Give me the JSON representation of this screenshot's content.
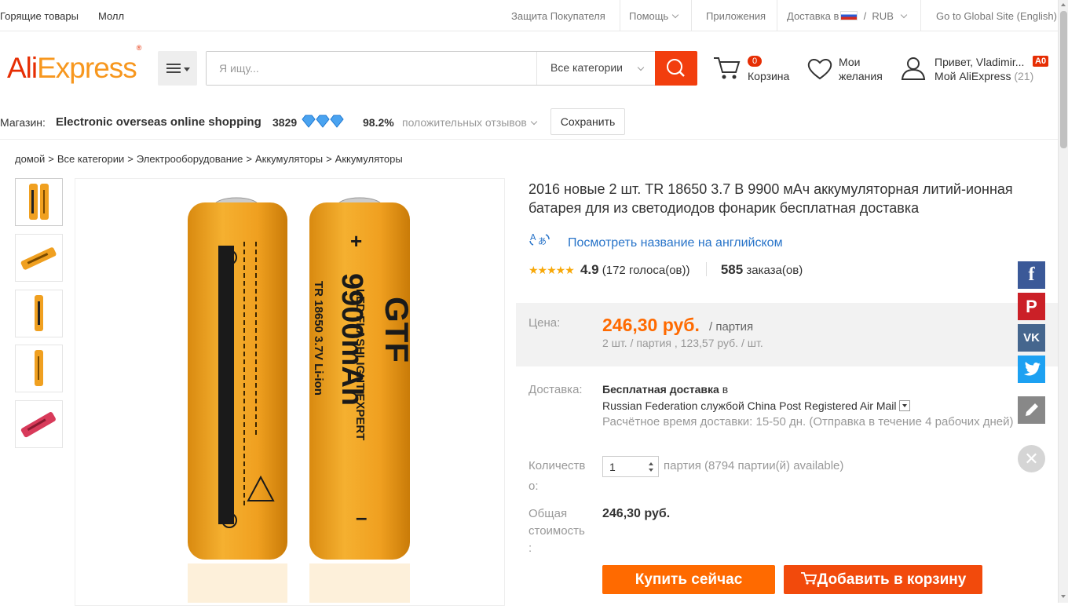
{
  "topbar": {
    "hot": "Горящие товары",
    "mall": "Молл",
    "buyer_protection": "Защита Покупателя",
    "help": "Помощь",
    "apps": "Приложения",
    "shipping_to": "Доставка в",
    "currency": "RUB",
    "global_site": "Go to Global Site (English)"
  },
  "header": {
    "logo_part1": "Ali",
    "logo_part2": "Express",
    "logo_mark": "®",
    "search_placeholder": "Я ищу...",
    "category_select": "Все категории",
    "cart_count": "0",
    "cart_label": "Корзина",
    "wishlist_line1": "Мои",
    "wishlist_line2": "желания",
    "greeting": "Привет, Vladimir...",
    "my_aliexpress": "Мой AliExpress",
    "my_count": "(21)",
    "account_badge": "A0"
  },
  "store": {
    "label": "Магазин:",
    "name": "Electronic overseas online shopping",
    "score": "3829",
    "positive_pct": "98.2%",
    "positive_label": "положительных отзывов",
    "save": "Сохранить"
  },
  "breadcrumb": [
    "домой",
    ">",
    "Все категории",
    ">",
    "Электрооборудование",
    ">",
    "Аккумуляторы",
    ">",
    "Аккумуляторы"
  ],
  "product": {
    "title": "2016 новые 2 шт. TR 18650 3.7 В 9900 мАч аккумуляторная литий-ионная батарея для из светодиодов фонарик бесплатная доставка",
    "translate_link": "Посмотреть название на английском",
    "rating": "4.9",
    "votes": "(172 голоса(ов))",
    "orders_num": "585",
    "orders_label": "заказа(ов)",
    "price_label": "Цена:",
    "price": "246,30 руб.",
    "price_unit": "/ партия",
    "price_sub": "2 шт. / партия , 123,57 руб. / шт.",
    "shipping_label": "Доставка:",
    "shipping_free": "Бесплатная доставка",
    "shipping_in": "в",
    "shipping_method": "Russian Federation службой China Post Registered Air Mail",
    "shipping_time": "Расчётное время доставки: 15-50 дн. (Отправка в течение 4 рабочих дней)",
    "qty_label_1": "Количеств",
    "qty_label_2": "о:",
    "qty_value": "1",
    "qty_available": "партия (8794 партии(й) available)",
    "total_label_1": "Общая",
    "total_label_2": "стоимость",
    "total_label_3": ":",
    "total": "246,30 руб.",
    "buy_now": "Купить сейчас",
    "add_to_cart": "Добавить в корзину"
  },
  "battery_print": {
    "brand": "GTF",
    "line1": "LED FLASHLIGHT EXPERT",
    "capacity": "9900mAh",
    "model": "TR 18650 3.7V Li-ion"
  },
  "colors": {
    "accent": "#ff6a00",
    "brand_red": "#e62e04",
    "link": "#2874c9",
    "battery": "#f0a020"
  }
}
